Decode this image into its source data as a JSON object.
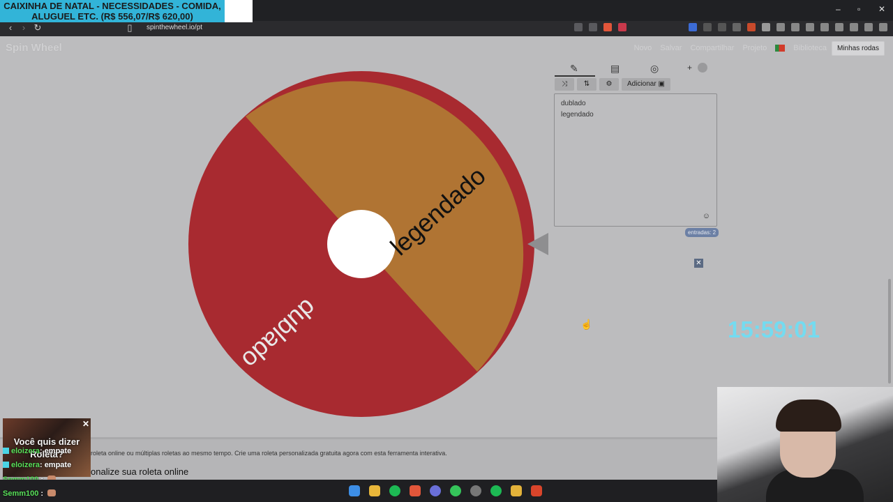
{
  "browser": {
    "banner": "CAIXINHA DE NATAL - NECESSIDADES - COMIDA, ALUGUEL ETC. (R$ 556,07/R$ 620,00)",
    "url": "spinthewheel.io/pt"
  },
  "site": {
    "logo": "Spin Wheel",
    "nav": [
      "Novo",
      "Salvar",
      "Compartilhar",
      "Projeto",
      "Biblioteca"
    ],
    "my_wheels": "Minhas rodas"
  },
  "wheel": {
    "segments": [
      {
        "label": "legendado",
        "color": "#b07433"
      },
      {
        "label": "dublado",
        "color": "#a82a30"
      }
    ]
  },
  "editor": {
    "add_label": "Adicionar",
    "entries": [
      "dublado",
      "legendado"
    ],
    "count_label": "entradas: 2"
  },
  "page": {
    "description": "roleta online ou múltiplas roletas ao mesmo tempo. Crie uma roleta personalizada gratuita agora com esta ferramenta interativa.",
    "subheading": "onalize sua roleta online"
  },
  "overlay": {
    "clock": "15:59:01",
    "roulette_title": "Você quis dizer",
    "roulette_sub": "Roleta?",
    "chat": [
      {
        "user": "eloizera",
        "msg": ": empate"
      },
      {
        "user": "eloizera",
        "msg": ": empate"
      },
      {
        "user": "Semm100",
        "msg": " :"
      },
      {
        "user": "Semm100",
        "msg": " :"
      }
    ]
  }
}
